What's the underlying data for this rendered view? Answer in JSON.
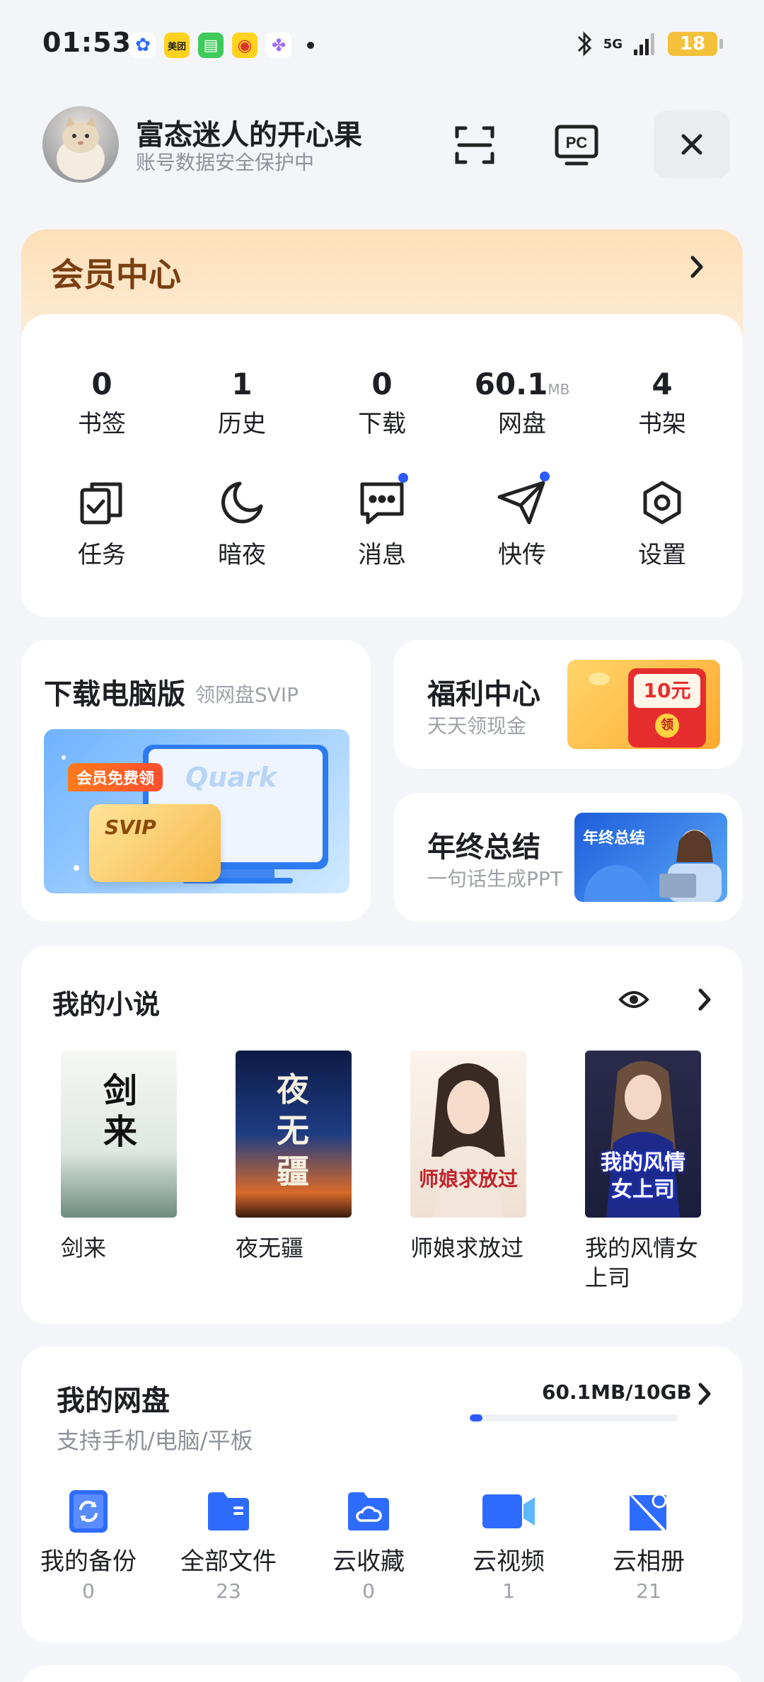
{
  "status_bar": {
    "time": "01:53",
    "apps": [
      {
        "name": "baidu-app-icon",
        "text": "✿",
        "color": "#ffffff",
        "fg": "#2f6bff"
      },
      {
        "name": "meituan-app-icon",
        "text": "美团",
        "color": "#ffd21f",
        "fg": "#222222"
      },
      {
        "name": "messages-app-icon",
        "text": "▤",
        "color": "#3ecb5a",
        "fg": "#ffffff"
      },
      {
        "name": "weibo-app-icon",
        "text": "◉",
        "color": "#ffd21f",
        "fg": "#e0322e"
      },
      {
        "name": "multicolor-app-icon",
        "text": "✤",
        "color": "#ffffff",
        "fg": "#9b6bff"
      }
    ],
    "network": "5G",
    "battery": "18"
  },
  "header": {
    "user_name": "富态迷人的开心果",
    "user_sub": "账号数据安全保护中"
  },
  "member": {
    "title": "会员中心",
    "stats": [
      {
        "value": "0",
        "unit": "",
        "label": "书签"
      },
      {
        "value": "1",
        "unit": "",
        "label": "历史"
      },
      {
        "value": "0",
        "unit": "",
        "label": "下载"
      },
      {
        "value": "60.1",
        "unit": "MB",
        "label": "网盘"
      },
      {
        "value": "4",
        "unit": "",
        "label": "书架"
      }
    ],
    "tools": [
      {
        "label": "任务",
        "icon": "task-icon"
      },
      {
        "label": "暗夜",
        "icon": "moon-icon"
      },
      {
        "label": "消息",
        "icon": "message-icon"
      },
      {
        "label": "快传",
        "icon": "send-icon"
      },
      {
        "label": "设置",
        "icon": "settings-icon"
      }
    ]
  },
  "promos": {
    "pc": {
      "title": "下载电脑版",
      "sub": "领网盘SVIP",
      "tag": "会员免费领",
      "card": "SVIP",
      "brand": "Quark"
    },
    "welfare": {
      "title": "福利中心",
      "sub": "天天领现金",
      "amount": "10元",
      "seal": "领"
    },
    "annual": {
      "title": "年终总结",
      "sub": "一句话生成PPT",
      "thumb": "年终总结"
    }
  },
  "novels": {
    "title": "我的小说",
    "books": [
      {
        "title": "剑来",
        "cover_text": "剑来",
        "bg1": "#f4f6f4",
        "bg2": "#6c8c7e",
        "fg": "#111111"
      },
      {
        "title": "夜无疆",
        "cover_text": "夜无疆",
        "bg1": "#0f1f4a",
        "bg2": "#d96a2a",
        "fg": "#f5f0e0"
      },
      {
        "title": "师娘求放过",
        "cover_text": "师娘求放过",
        "bg1": "#fbf3ec",
        "bg2": "#e9d5c6",
        "fg": "#c0242a"
      },
      {
        "title": "我的风情女上司",
        "cover_text": "我的风情女上司",
        "bg1": "#1b1e3b",
        "bg2": "#4c4c8a",
        "fg": "#ffffff"
      }
    ]
  },
  "disk": {
    "title": "我的网盘",
    "sub": "支持手机/电脑/平板",
    "usage": "60.1MB/10GB",
    "usage_fraction": 0.006,
    "items": [
      {
        "label": "我的备份",
        "count": "0",
        "icon": "backup-icon"
      },
      {
        "label": "全部文件",
        "count": "23",
        "icon": "folder-icon"
      },
      {
        "label": "云收藏",
        "count": "0",
        "icon": "cloud-folder-icon"
      },
      {
        "label": "云视频",
        "count": "1",
        "icon": "video-icon"
      },
      {
        "label": "云相册",
        "count": "21",
        "icon": "album-icon"
      }
    ]
  }
}
